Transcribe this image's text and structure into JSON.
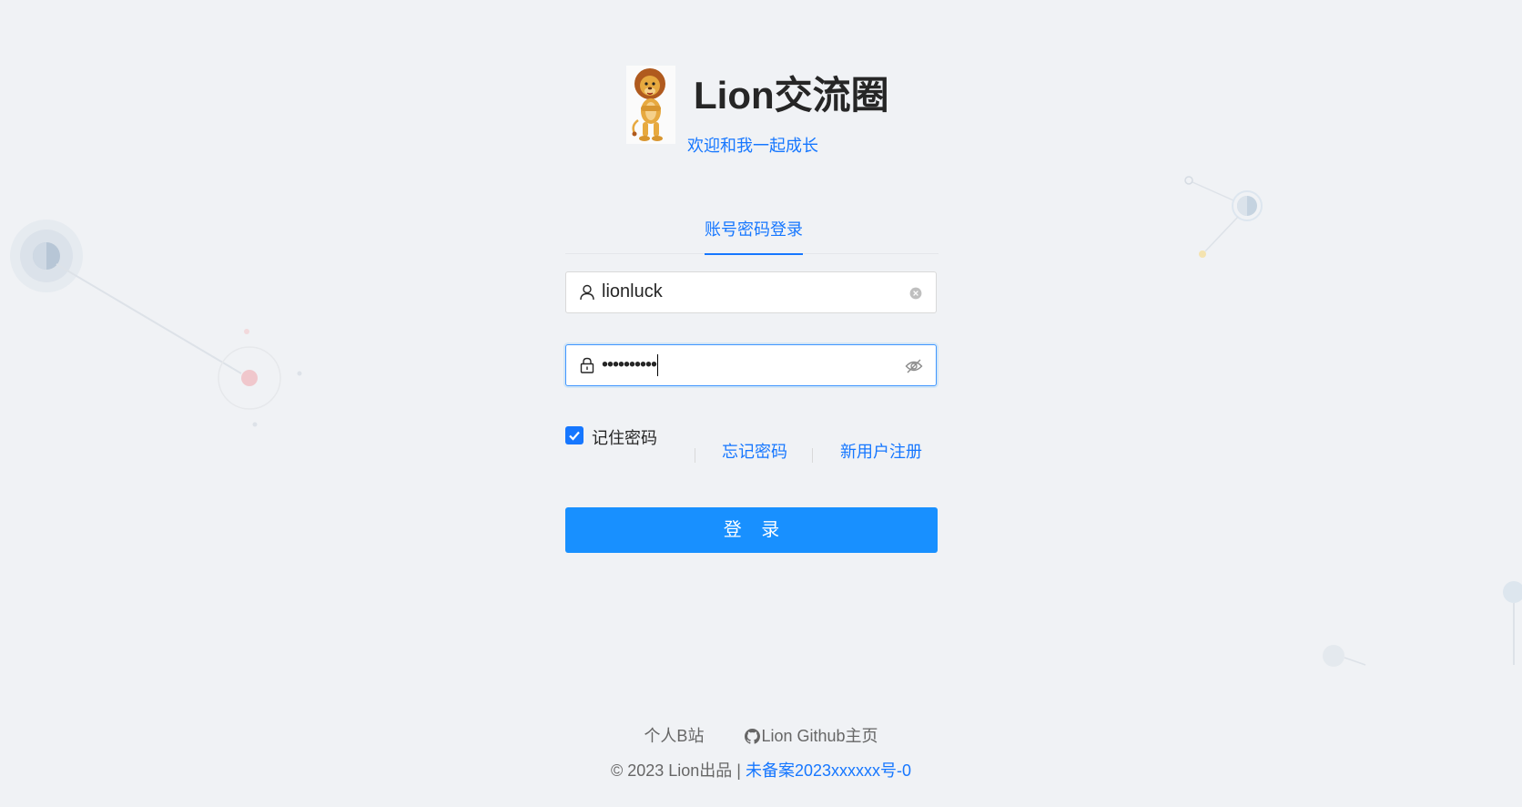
{
  "header": {
    "title": "Lion交流圈",
    "subtitle": "欢迎和我一起成长",
    "logo_icon": "lion-mascot-icon"
  },
  "login": {
    "tab_label": "账号密码登录",
    "username_value": "lionluck",
    "password_value": "••••••••••",
    "remember_label": "记住密码",
    "remember_checked": true,
    "forgot_label": "忘记密码",
    "register_label": "新用户注册",
    "submit_label": "登 录"
  },
  "footer": {
    "bilibili_label": "个人B站",
    "github_label": "Lion Github主页",
    "copyright": "© 2023 Lion出品 |",
    "icp_label": "未备案2023xxxxxx号-0"
  },
  "colors": {
    "primary": "#1677ff",
    "button": "#1890ff",
    "background": "#f0f2f5"
  }
}
